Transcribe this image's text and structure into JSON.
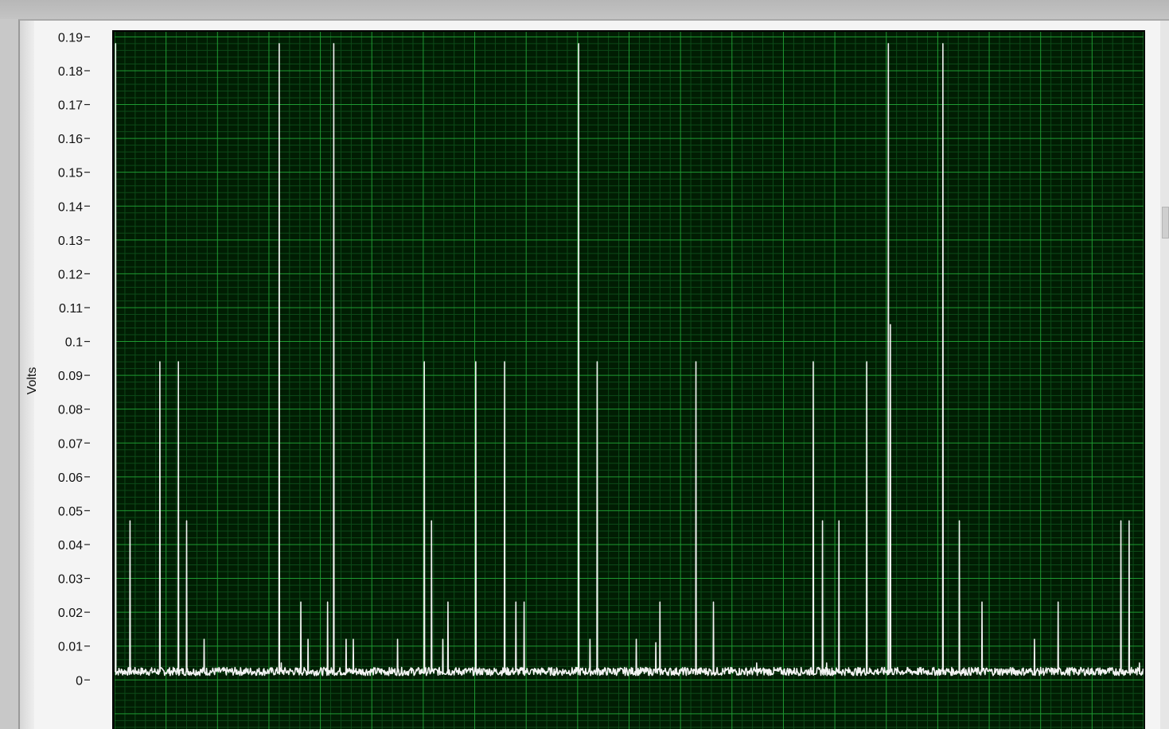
{
  "chart_data": {
    "type": "line",
    "title": "",
    "xlabel": "",
    "ylabel": "Volts",
    "ylim": [
      -0.0145,
      0.1915
    ],
    "yticks": [
      "0.19",
      "0.18",
      "0.17",
      "0.16",
      "0.15",
      "0.14",
      "0.13",
      "0.12",
      "0.11",
      "0.1",
      "0.09",
      "0.08",
      "0.07",
      "0.06",
      "0.05",
      "0.04",
      "0.03",
      "0.02",
      "0.01",
      "0"
    ],
    "ytick_values": [
      0.19,
      0.18,
      0.17,
      0.16,
      0.15,
      0.14,
      0.13,
      0.12,
      0.11,
      0.1,
      0.09,
      0.08,
      0.07,
      0.06,
      0.05,
      0.04,
      0.03,
      0.02,
      0.01,
      0
    ],
    "grid": true,
    "baseline": 0.0025,
    "noise": 0.0012,
    "x": [
      0,
      1000
    ],
    "series": [
      {
        "name": "",
        "peaks": [
          [
            1,
            0.188
          ],
          [
            15,
            0.047
          ],
          [
            44,
            0.094
          ],
          [
            62,
            0.094
          ],
          [
            70,
            0.047
          ],
          [
            87,
            0.012
          ],
          [
            160,
            0.188
          ],
          [
            162,
            0.005
          ],
          [
            181,
            0.023
          ],
          [
            188,
            0.012
          ],
          [
            207,
            0.023
          ],
          [
            213,
            0.188
          ],
          [
            225,
            0.012
          ],
          [
            232,
            0.012
          ],
          [
            275,
            0.012
          ],
          [
            301,
            0.094
          ],
          [
            308,
            0.047
          ],
          [
            319,
            0.012
          ],
          [
            324,
            0.023
          ],
          [
            351,
            0.094
          ],
          [
            379,
            0.094
          ],
          [
            390,
            0.023
          ],
          [
            398,
            0.023
          ],
          [
            451,
            0.188
          ],
          [
            462,
            0.012
          ],
          [
            469,
            0.094
          ],
          [
            507,
            0.012
          ],
          [
            526,
            0.011
          ],
          [
            530,
            0.023
          ],
          [
            565,
            0.094
          ],
          [
            582,
            0.023
          ],
          [
            624,
            0.005
          ],
          [
            679,
            0.094
          ],
          [
            688,
            0.047
          ],
          [
            692,
            0.005
          ],
          [
            704,
            0.047
          ],
          [
            731,
            0.094
          ],
          [
            752,
            0.188
          ],
          [
            754,
            0.105
          ],
          [
            805,
            0.188
          ],
          [
            821,
            0.047
          ],
          [
            843,
            0.023
          ],
          [
            894,
            0.012
          ],
          [
            917,
            0.023
          ],
          [
            978,
            0.047
          ],
          [
            986,
            0.047
          ],
          [
            996,
            0.005
          ]
        ]
      }
    ]
  }
}
